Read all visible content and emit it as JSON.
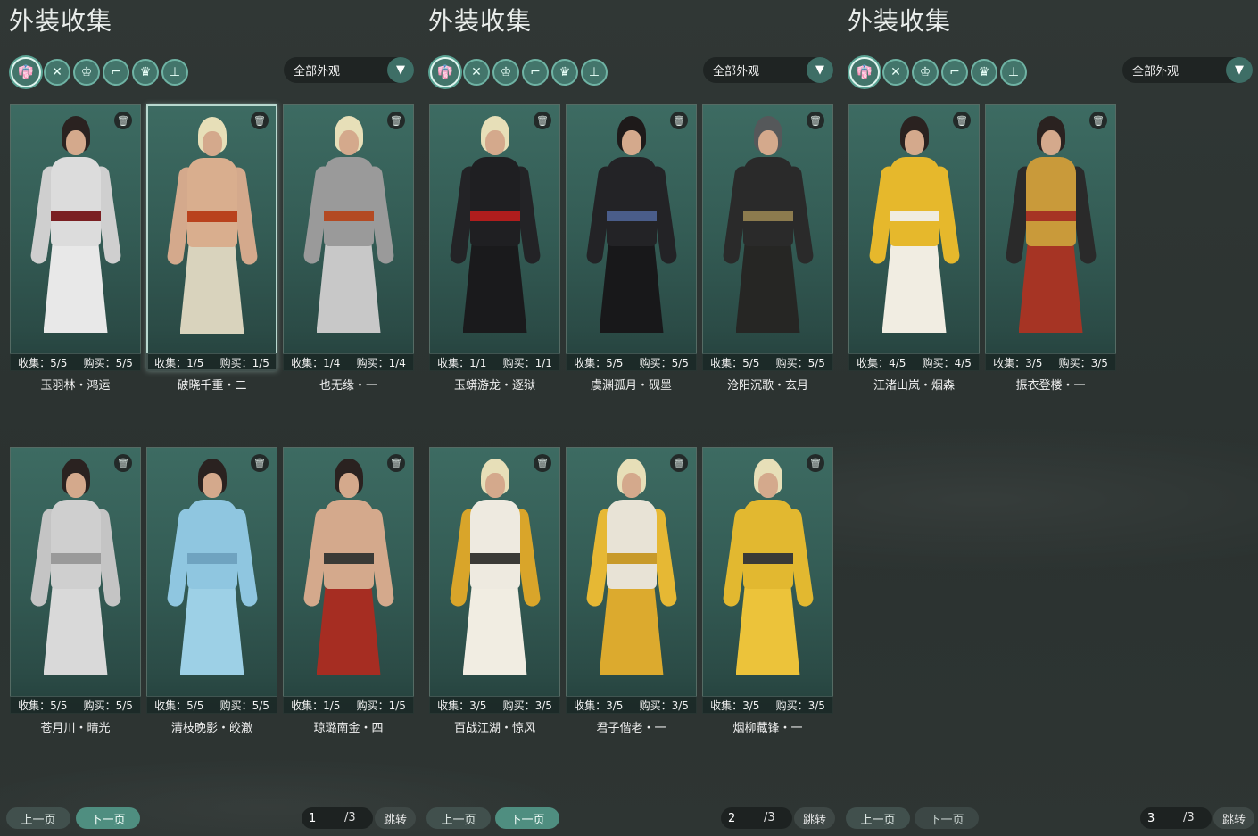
{
  "panels": [
    {
      "title": "外装收集",
      "dropdown": "全部外观",
      "cards": [
        {
          "name": "玉羽林・鸿运",
          "collect": "收集：5/5",
          "buy": "购买：5/5",
          "palette": {
            "hair": "#2a2220",
            "body": "#dcdcdc",
            "sash": "#7a1f22",
            "robe": "#e8e8e8",
            "arm": "#cfcfcf"
          }
        },
        {
          "name": "破晓千重・二",
          "collect": "收集：1/5",
          "buy": "购买：1/5",
          "palette": {
            "hair": "#e7dfb8",
            "body": "#d9ae8e",
            "sash": "#b9421d",
            "robe": "#d9d3bd",
            "arm": "#d4a98c"
          }
        },
        {
          "name": "也无缘・一",
          "collect": "收集：1/4",
          "buy": "购买：1/4",
          "palette": {
            "hair": "#e7dfb8",
            "body": "#9a9a9a",
            "sash": "#b34a23",
            "robe": "#c8c8c8",
            "arm": "#9a9a9a"
          }
        },
        {
          "name": "苍月川・晴光",
          "collect": "收集：5/5",
          "buy": "购买：5/5",
          "palette": {
            "hair": "#2a2220",
            "body": "#cfcfcf",
            "sash": "#9a9a9a",
            "robe": "#d9d9d9",
            "arm": "#c4c4c4"
          }
        },
        {
          "name": "清枝晚影・皎澈",
          "collect": "收集：5/5",
          "buy": "购买：5/5",
          "palette": {
            "hair": "#2a2220",
            "body": "#8fc6e0",
            "sash": "#6fa3c0",
            "robe": "#9dd0e6",
            "arm": "#8fc6e0"
          }
        },
        {
          "name": "琼璐南金・四",
          "collect": "收集：1/5",
          "buy": "购买：1/5",
          "palette": {
            "hair": "#2a2220",
            "body": "#d4a98c",
            "sash": "#3a3a36",
            "robe": "#a62d22",
            "arm": "#d4a98c"
          }
        }
      ],
      "pager": {
        "prev": "上一页",
        "next": "下一页",
        "page": "1",
        "total": "/3",
        "jump": "跳转"
      }
    },
    {
      "title": "外装收集",
      "dropdown": "全部外观",
      "cards": [
        {
          "name": "玉蟒游龙・逐狱",
          "collect": "收集：1/1",
          "buy": "购买：1/1",
          "palette": {
            "hair": "#e7dfb8",
            "body": "#1f1f22",
            "sash": "#b01d1d",
            "robe": "#1a1a1c",
            "arm": "#232326"
          }
        },
        {
          "name": "虞渊孤月・砚墨",
          "collect": "收集：5/5",
          "buy": "购买：5/5",
          "palette": {
            "hair": "#1e1a1a",
            "body": "#232326",
            "sash": "#4a5d8a",
            "robe": "#18181a",
            "arm": "#232326"
          }
        },
        {
          "name": "沧阳沉歌・玄月",
          "collect": "收集：5/5",
          "buy": "购买：5/5",
          "palette": {
            "hair": "#55585a",
            "body": "#2a2a2a",
            "sash": "#8c7b4e",
            "robe": "#262624",
            "arm": "#2a2a2a"
          }
        },
        {
          "name": "百战江湖・惊风",
          "collect": "收集：3/5",
          "buy": "购买：3/5",
          "palette": {
            "hair": "#e7dfb8",
            "body": "#eeeae0",
            "sash": "#3a3a36",
            "robe": "#f1ede2",
            "arm": "#d9a52a"
          }
        },
        {
          "name": "君子偕老・一",
          "collect": "收集：3/5",
          "buy": "购买：3/5",
          "palette": {
            "hair": "#e7dfb8",
            "body": "#e8e3d6",
            "sash": "#c89a2a",
            "robe": "#dcaa2e",
            "arm": "#e6b834"
          }
        },
        {
          "name": "烟柳藏锋・一",
          "collect": "收集：3/5",
          "buy": "购买：3/5",
          "palette": {
            "hair": "#e7dfb8",
            "body": "#e2b830",
            "sash": "#3a3a36",
            "robe": "#ecc33a",
            "arm": "#e2b830"
          }
        }
      ],
      "pager": {
        "prev": "上一页",
        "next": "下一页",
        "page": "2",
        "total": "/3",
        "jump": "跳转"
      }
    },
    {
      "title": "外装收集",
      "dropdown": "全部外观",
      "cards": [
        {
          "name": "江渚山岚・烟森",
          "collect": "收集：4/5",
          "buy": "购买：4/5",
          "palette": {
            "hair": "#2a2220",
            "body": "#e6b82c",
            "sash": "#f0ece0",
            "robe": "#f1ede2",
            "arm": "#e6b82c"
          }
        },
        {
          "name": "振衣登楼・一",
          "collect": "收集：3/5",
          "buy": "购买：3/5",
          "palette": {
            "hair": "#2a2220",
            "body": "#c99a3a",
            "sash": "#a63424",
            "robe": "#a63424",
            "arm": "#2a2a2a"
          }
        }
      ],
      "pager": {
        "prev": "上一页",
        "next": "下一页",
        "page": "3",
        "total": "/3",
        "jump": "跳转"
      }
    }
  ],
  "filter_icons": [
    "outfit-icon",
    "weapon-icon",
    "accessory-icon",
    "shoes-icon",
    "mask-icon",
    "pants-icon"
  ],
  "filter_glyphs": [
    "👘",
    "✕",
    "♔",
    "⌐",
    "♛",
    "⊥"
  ],
  "icons": {
    "trash": "🗑",
    "caret": "▼"
  },
  "colors": {
    "accent": "#4f8e80",
    "card_bg": "#3d6b62",
    "selected_border": "#b9d8cf"
  }
}
